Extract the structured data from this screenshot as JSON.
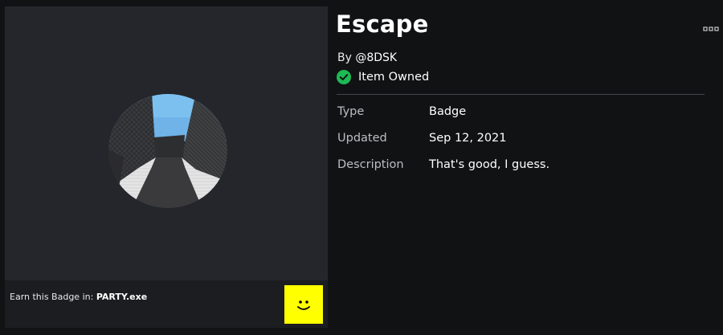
{
  "badge": {
    "title": "Escape",
    "creator_prefix": "By ",
    "creator": "@8DSK",
    "owned_label": "Item Owned",
    "earn_prefix": "Earn this Badge in: ",
    "game_name": "PARTY.exe"
  },
  "details": [
    {
      "label": "Type",
      "value": "Badge"
    },
    {
      "label": "Updated",
      "value": "Sep 12, 2021"
    },
    {
      "label": "Description",
      "value": "That's good, I guess."
    }
  ],
  "colors": {
    "owned_check": "#1db954",
    "game_thumb": "#ffff00",
    "sky": "#6fb3e8"
  },
  "icons": {
    "more": "more-options-icon",
    "owned": "checkmark-circle-icon",
    "game": "smiley-face-icon"
  }
}
